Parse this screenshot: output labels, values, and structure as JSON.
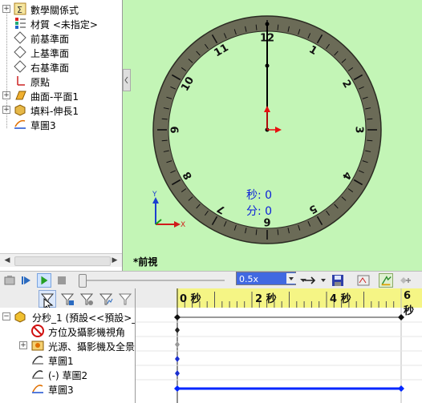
{
  "feature_tree": {
    "items": [
      {
        "label": "數學關係式",
        "icon": "equations-icon"
      },
      {
        "label": "材質 <未指定>",
        "icon": "material-icon"
      },
      {
        "label": "前基準面",
        "icon": "plane-icon"
      },
      {
        "label": "上基準面",
        "icon": "plane-icon"
      },
      {
        "label": "右基準面",
        "icon": "plane-icon"
      },
      {
        "label": "原點",
        "icon": "origin-icon"
      },
      {
        "label": "曲面-平面1",
        "icon": "surface-icon"
      },
      {
        "label": "填料-伸長1",
        "icon": "extrude-icon"
      },
      {
        "label": "草圖3",
        "icon": "sketch-icon"
      }
    ]
  },
  "viewport": {
    "view_label": "*前視",
    "seconds_readout": "秒: 0",
    "minutes_readout": "分: 0",
    "clock_numbers": [
      "12",
      "1",
      "2",
      "3",
      "4",
      "5",
      "6",
      "7",
      "8",
      "9",
      "10",
      "11"
    ],
    "axis_y": "Y",
    "axis_x": "X",
    "background": "#c3f5b6",
    "ring_color": "#6b6b57"
  },
  "motion_toolbar": {
    "speed_value": "0.5x"
  },
  "motion_tree": {
    "items": [
      {
        "label": "分秒_1 (預設<<預設>_",
        "icon": "assembly-icon"
      },
      {
        "label": "方位及攝影機視角",
        "icon": "orientation-icon"
      },
      {
        "label": "光源、攝影機及全景",
        "icon": "lights-icon"
      },
      {
        "label": "草圖1",
        "icon": "sketch-icon"
      },
      {
        "label": "(-) 草圖2",
        "icon": "sketch-icon"
      },
      {
        "label": "草圖3",
        "icon": "sketch-icon"
      }
    ]
  },
  "timeline": {
    "ruler_labels": [
      "0 秒",
      "2 秒",
      "4 秒",
      "6 秒"
    ],
    "accent": "#0026ff"
  }
}
